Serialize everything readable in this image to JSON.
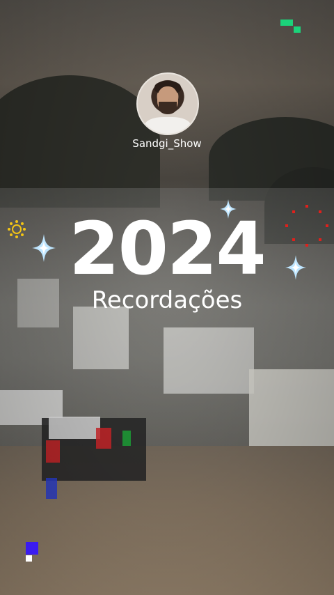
{
  "profile": {
    "username": "Sandgi_Show"
  },
  "story": {
    "year": "2024",
    "title": "Recordações"
  },
  "decorations": {
    "sparkles": [
      "sparkle-icon",
      "sparkle-icon",
      "sparkle-icon"
    ],
    "sun_icon": "sun-icon",
    "dots_ring_icon": "dots-ring-icon",
    "pixel_icons": [
      "green-pixel-icon",
      "blue-pixel-icon"
    ]
  },
  "colors": {
    "text": "#ffffff",
    "sparkle": "#bfe6ff",
    "sun": "#f3c515",
    "dots": "#e0201c",
    "green_pixel": "#1bd37a",
    "blue_pixel": "#3a1bf0"
  }
}
